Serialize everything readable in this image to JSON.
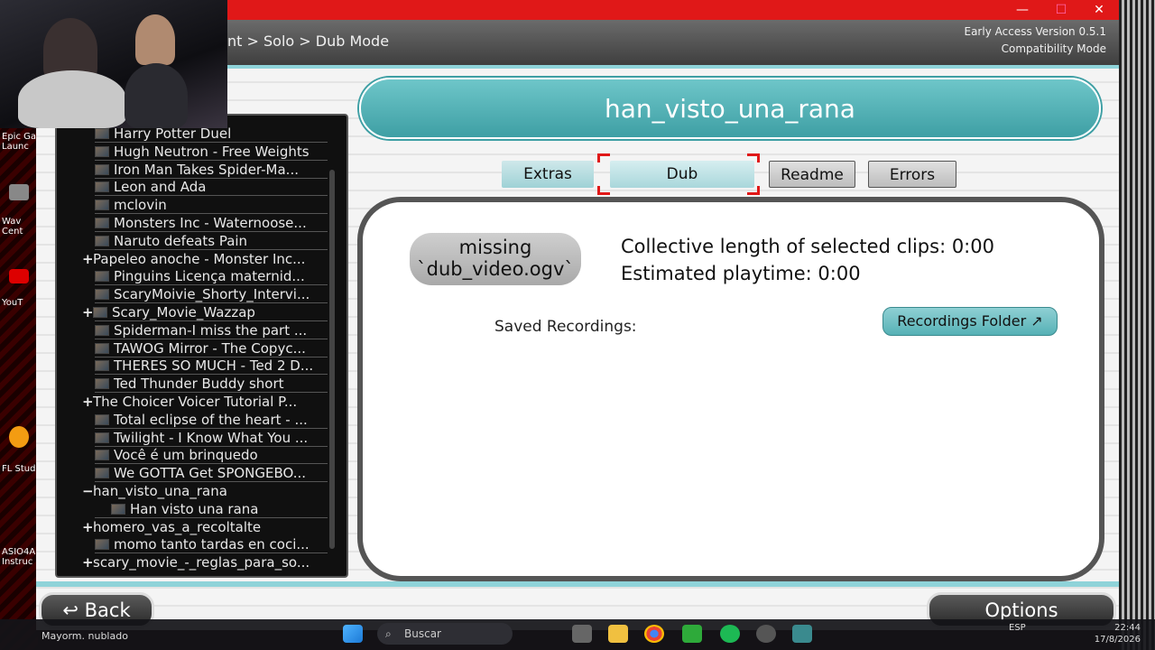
{
  "window": {
    "minimize": "—",
    "maximize": "☐",
    "close": "✕"
  },
  "header": {
    "breadcrumb": "nt > Solo > Dub Mode",
    "version_line1": "Early Access Version 0.5.1",
    "version_line2": "Compatibility Mode"
  },
  "desktop_icons": [
    {
      "label": "Epic Ga\nLaunc",
      "icon": "epic-games-icon"
    },
    {
      "label": "Wav\nCent",
      "icon": "waves-icon"
    },
    {
      "label": "YouT",
      "icon": "youtube-icon"
    },
    {
      "label": "FL Stud",
      "icon": "fl-studio-icon"
    },
    {
      "label": "ASIO4A\nInstruc",
      "icon": "asio-icon"
    }
  ],
  "tree": {
    "items": [
      {
        "label": "Harry Potter Duel",
        "expander": "",
        "thumb": true,
        "indent": 1
      },
      {
        "label": "Hugh Neutron - Free Weights",
        "expander": "",
        "thumb": true,
        "indent": 1
      },
      {
        "label": "Iron Man Takes Spider-Ma...",
        "expander": "",
        "thumb": true,
        "indent": 1
      },
      {
        "label": "Leon and Ada",
        "expander": "",
        "thumb": true,
        "indent": 1
      },
      {
        "label": "mclovin",
        "expander": "",
        "thumb": true,
        "indent": 1
      },
      {
        "label": "Monsters Inc - Waternoose...",
        "expander": "",
        "thumb": true,
        "indent": 1
      },
      {
        "label": "Naruto defeats Pain",
        "expander": "",
        "thumb": true,
        "indent": 1
      },
      {
        "label": "Papeleo anoche - Monster Inc...",
        "expander": "+",
        "thumb": false,
        "indent": 0
      },
      {
        "label": "Pinguins Licença maternid...",
        "expander": "",
        "thumb": true,
        "indent": 1
      },
      {
        "label": "ScaryMoivie_Shorty_Intervi...",
        "expander": "",
        "thumb": true,
        "indent": 1
      },
      {
        "label": "Scary_Movie_Wazzap",
        "expander": "+",
        "thumb": true,
        "indent": 1
      },
      {
        "label": "Spiderman-I miss the part ...",
        "expander": "",
        "thumb": true,
        "indent": 1
      },
      {
        "label": "TAWOG Mirror - The Copyc...",
        "expander": "",
        "thumb": true,
        "indent": 1
      },
      {
        "label": "THERES SO MUCH - Ted 2 D...",
        "expander": "",
        "thumb": true,
        "indent": 1
      },
      {
        "label": "Ted Thunder Buddy short",
        "expander": "",
        "thumb": true,
        "indent": 1
      },
      {
        "label": "The Choicer Voicer Tutorial P...",
        "expander": "+",
        "thumb": false,
        "indent": 0
      },
      {
        "label": "Total eclipse of the heart - ...",
        "expander": "",
        "thumb": true,
        "indent": 1
      },
      {
        "label": "Twilight - I Know What You ...",
        "expander": "",
        "thumb": true,
        "indent": 1
      },
      {
        "label": "Você é um brinquedo",
        "expander": "",
        "thumb": true,
        "indent": 1
      },
      {
        "label": "We GOTTA Get SPONGEBO...",
        "expander": "",
        "thumb": true,
        "indent": 1
      },
      {
        "label": "han_visto_una_rana",
        "expander": "−",
        "thumb": false,
        "indent": 0
      },
      {
        "label": "Han visto una rana",
        "expander": "",
        "thumb": true,
        "indent": 2
      },
      {
        "label": "homero_vas_a_recoltalte",
        "expander": "+",
        "thumb": false,
        "indent": 0
      },
      {
        "label": "momo tanto tardas en coci...",
        "expander": "",
        "thumb": true,
        "indent": 1
      },
      {
        "label": "scary_movie_-_reglas_para_so...",
        "expander": "+",
        "thumb": false,
        "indent": 0
      }
    ]
  },
  "banner": {
    "title": "han_visto_una_rana"
  },
  "tabs": [
    {
      "label": "Extras"
    },
    {
      "label": "Dub"
    },
    {
      "label": "Readme"
    },
    {
      "label": "Errors"
    }
  ],
  "dub_panel": {
    "missing_line1": "missing",
    "missing_line2": "`dub_video.ogv`",
    "collective_length": "Collective length of selected clips:  0:00",
    "estimated_playtime": "Estimated playtime:  0:00",
    "saved_recordings": "Saved Recordings:",
    "recordings_folder": "Recordings Folder ↗"
  },
  "footer": {
    "back": "↩ Back",
    "options": "Options"
  },
  "taskbar": {
    "weather": "Mayorm. nublado",
    "search_placeholder": "Buscar",
    "language": "ESP",
    "time": "22:44",
    "date": "17/8/2026"
  },
  "colors": {
    "titlebar": "#e01818",
    "accent_teal": "#56b1b6",
    "selection": "#e01818"
  }
}
